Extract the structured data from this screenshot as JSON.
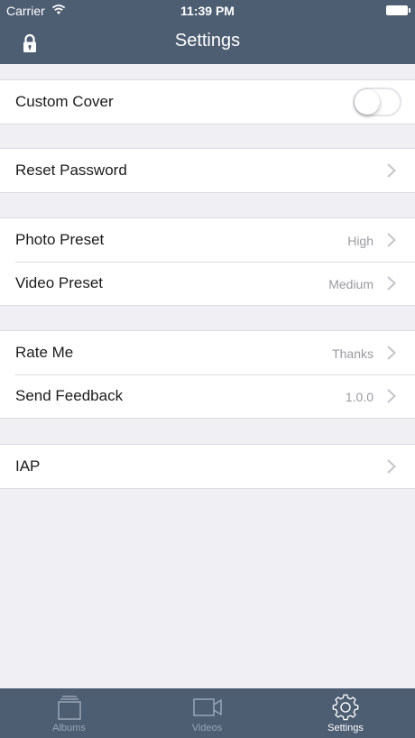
{
  "status_bar": {
    "carrier": "Carrier",
    "time": "11:39 PM"
  },
  "nav": {
    "title": "Settings"
  },
  "groups": [
    {
      "rows": [
        {
          "label": "Custom Cover",
          "toggle_on": false
        }
      ]
    },
    {
      "rows": [
        {
          "label": "Reset Password",
          "value": ""
        }
      ]
    },
    {
      "rows": [
        {
          "label": "Photo Preset",
          "value": "High"
        },
        {
          "label": "Video Preset",
          "value": "Medium"
        }
      ]
    },
    {
      "rows": [
        {
          "label": "Rate Me",
          "value": "Thanks"
        },
        {
          "label": "Send Feedback",
          "value": "1.0.0"
        }
      ]
    },
    {
      "rows": [
        {
          "label": "IAP",
          "value": ""
        }
      ]
    }
  ],
  "tabs": [
    {
      "label": "Albums",
      "icon": "albums-icon"
    },
    {
      "label": "Videos",
      "icon": "video-camera-icon"
    },
    {
      "label": "Settings",
      "icon": "gear-icon",
      "active": true
    }
  ],
  "colors": {
    "nav_bg": "#4d5d72",
    "page_bg": "#efeff4",
    "secondary_text": "#9a9a9f"
  }
}
